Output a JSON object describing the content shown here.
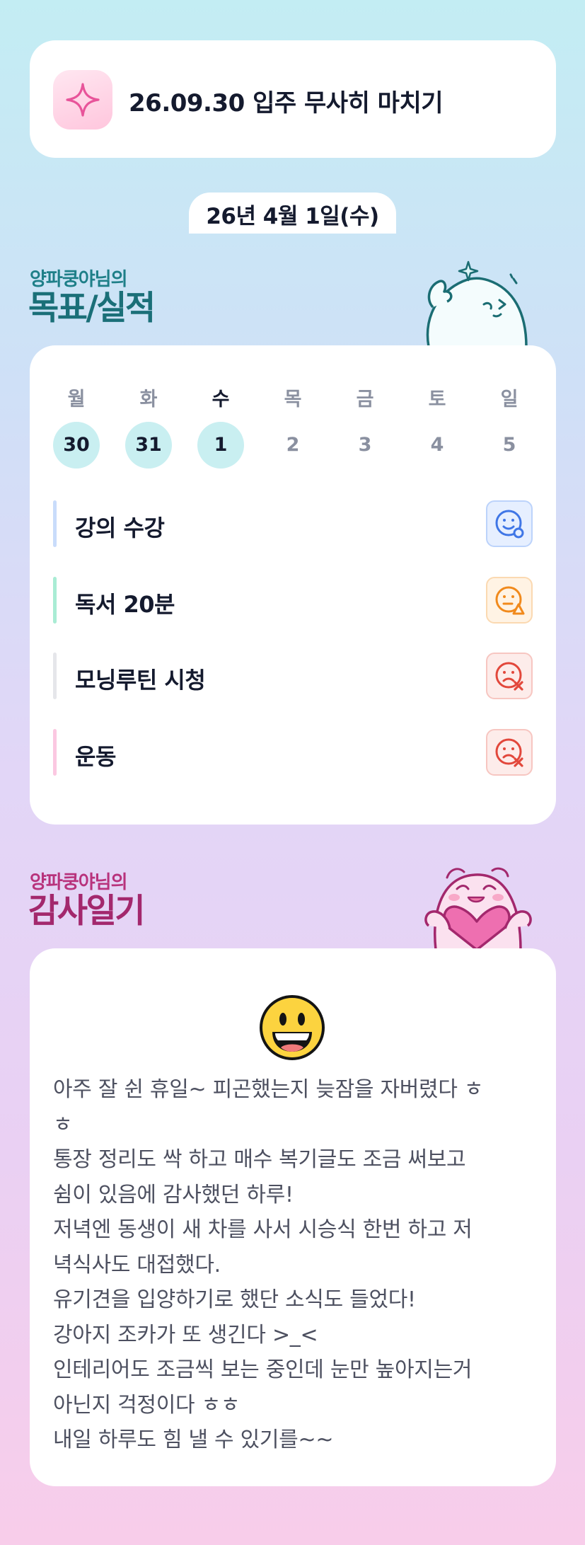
{
  "goal_banner": {
    "text": "26.09.30 입주 무사히 마치기",
    "icon": "sparkle-icon"
  },
  "date": "26년 4월 1일(수)",
  "goals_section": {
    "owner": "양파쿵야님의",
    "title": "목표/실적"
  },
  "calendar": {
    "weekdays": [
      "월",
      "화",
      "수",
      "목",
      "금",
      "토",
      "일"
    ],
    "days": [
      "30",
      "31",
      "1",
      "2",
      "3",
      "4",
      "5"
    ],
    "today_index": 2,
    "completed_days": [
      0,
      1,
      2
    ]
  },
  "tasks": [
    {
      "label": "강의 수강",
      "status": "smile-icon",
      "bar_color": "#c9dcfb",
      "face_color": "#3f76e6",
      "face_bg": "#e6efff",
      "face_border": "#bcd3fb"
    },
    {
      "label": "독서 20분",
      "status": "neutral-warning-icon",
      "bar_color": "#a9ecd4",
      "face_color": "#f18a1c",
      "face_bg": "#fff3e4",
      "face_border": "#fbd9b1"
    },
    {
      "label": "모닝루틴 시청",
      "status": "sad-x-icon",
      "bar_color": "#e5e6ea",
      "face_color": "#e2473b",
      "face_bg": "#fdecea",
      "face_border": "#f7c6c1"
    },
    {
      "label": "운동",
      "status": "sad-x-icon",
      "bar_color": "#fbc8e1",
      "face_color": "#e2473b",
      "face_bg": "#fdecea",
      "face_border": "#f7c6c1"
    }
  ],
  "diary_section": {
    "owner": "양파쿵야님의",
    "title": "감사일기"
  },
  "diary": {
    "emoji": "grinning-face-icon",
    "lines": [
      "아주 잘 쉰 휴일~ 피곤했는지 늦잠을 자버렸다 ㅎ",
      "ㅎ",
      "통장 정리도 싹 하고 매수 복기글도 조금 써보고",
      "쉼이 있음에 감사했던 하루!",
      "저녁엔 동생이 새 차를 사서 시승식 한번 하고 저",
      "녁식사도 대접했다.",
      "유기견을 입양하기로 했단 소식도 들었다!",
      "강아지 조카가 또 생긴다 >_<",
      "인테리어도 조금씩 보는 중인데 눈만 높아지는거",
      "아닌지 걱정이다 ㅎㅎ",
      "내일 하루도 힘 낼 수 있기를~~"
    ]
  },
  "colors": {
    "goals_title": "#1a6f78",
    "diary_title": "#a3286d",
    "completed_day_bg": "#c9eff1"
  }
}
